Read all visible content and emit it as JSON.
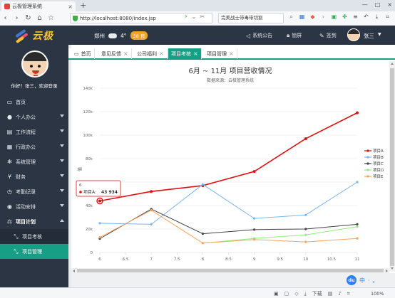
{
  "browser": {
    "tab_title": "云极管理系统",
    "tab_close": "×",
    "new_tab": "+",
    "url": "http://localhost:8080/index.jsp",
    "search_text": "完美战士带毒带切割",
    "window_controls": [
      "—",
      "□",
      "×"
    ]
  },
  "header": {
    "logo_text": "云极",
    "city": "郑州",
    "temperature": "4°",
    "weather_badge": "38 良",
    "announce": "系统公告",
    "lock": "锁屏",
    "signin": "签到",
    "username": "张三"
  },
  "sidebar": {
    "welcome": "你好！张三，欢迎登录",
    "items": [
      {
        "label": "首页",
        "icon": "monitor-icon"
      },
      {
        "label": "个人办公",
        "icon": "user-icon"
      },
      {
        "label": "工作流程",
        "icon": "file-icon"
      },
      {
        "label": "行政办公",
        "icon": "calendar-icon"
      },
      {
        "label": "系统管理",
        "icon": "gear-icon"
      },
      {
        "label": "财务",
        "icon": "yen-icon"
      },
      {
        "label": "考勤记录",
        "icon": "clock-icon"
      },
      {
        "label": "活动安排",
        "icon": "target-icon"
      },
      {
        "label": "项目计划",
        "icon": "scale-icon"
      },
      {
        "label": "项目考核",
        "icon": "arrows-icon"
      },
      {
        "label": "项目管理",
        "icon": "arrows-icon"
      }
    ]
  },
  "content_tabs": [
    {
      "label": "首页"
    },
    {
      "label": "意见反馈"
    },
    {
      "label": "公司福利"
    },
    {
      "label": "项目考核"
    },
    {
      "label": "项目管理"
    }
  ],
  "tooltip": {
    "header": "6",
    "series": "项目A:",
    "value": "43 934"
  },
  "chart_data": {
    "type": "line",
    "title": "6月 ~ 11月 项目营收情况",
    "subtitle": "数据来源：云极管理系统",
    "ylabel": "值",
    "xlabel": "",
    "x": [
      6,
      7,
      8,
      9,
      10,
      11
    ],
    "x_ticks": [
      "6",
      "6.5",
      "7",
      "7.5",
      "8",
      "8.5",
      "9",
      "9.5",
      "10",
      "10.5",
      "11"
    ],
    "y_ticks": [
      "0",
      "20k",
      "40k",
      "60k",
      "80k",
      "100k",
      "120k",
      "140k"
    ],
    "ylim": [
      0,
      140000
    ],
    "xlim": [
      6,
      11
    ],
    "legend_position": "right",
    "series": [
      {
        "name": "项目A",
        "color": "#e01010",
        "values": [
          43934,
          52000,
          57000,
          69000,
          97000,
          119000
        ]
      },
      {
        "name": "项目B",
        "color": "#7cb5ec",
        "values": [
          24916,
          24000,
          58000,
          29000,
          32000,
          60000
        ]
      },
      {
        "name": "项目C",
        "color": "#434348",
        "values": [
          11744,
          37000,
          16000,
          19500,
          20000,
          24000
        ]
      },
      {
        "name": "项目D",
        "color": "#90ed7d",
        "values": null,
        "values_pts": [
          null,
          null,
          7988,
          12000,
          15000,
          22000
        ]
      },
      {
        "name": "项目E",
        "color": "#f7a35c",
        "values": [
          12908,
          36000,
          8000,
          11000,
          9000,
          12000
        ]
      }
    ]
  },
  "statusbar": {
    "download": "下载",
    "zoom": "100%"
  },
  "ime": {
    "du": "du",
    "zh": "中",
    "dot": "·",
    "punct": "。"
  }
}
